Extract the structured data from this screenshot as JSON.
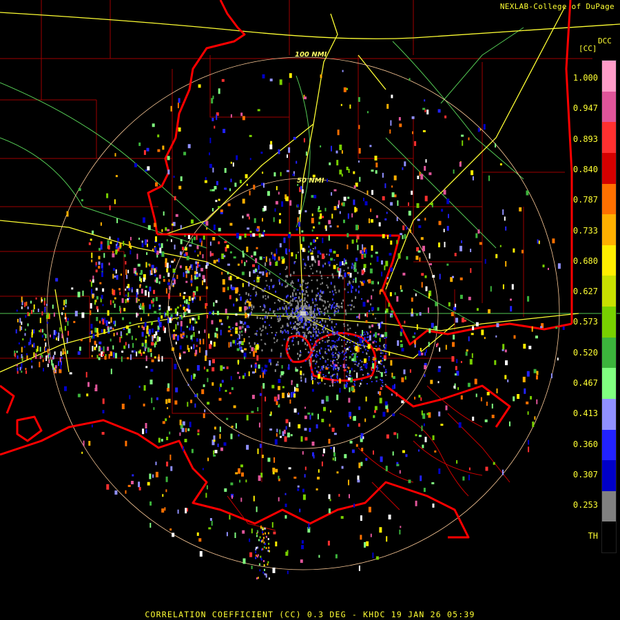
{
  "header": {
    "credit": "NEXLAB-College of DuPage"
  },
  "footer": {
    "title": "CORRELATION COEFFICIENT (CC) 0.3 DEG - KHDC 19 JAN 26 05:39"
  },
  "legend": {
    "product": "DCC",
    "unit": "[CC]",
    "ticks": [
      "1.000",
      "0.947",
      "0.893",
      "0.840",
      "0.787",
      "0.733",
      "0.680",
      "0.627",
      "0.573",
      "0.520",
      "0.467",
      "0.413",
      "0.360",
      "0.307",
      "0.253",
      "TH"
    ],
    "colors": [
      "#ff9cc8",
      "#e0559a",
      "#ff3030",
      "#d40000",
      "#ff7000",
      "#ffb000",
      "#ffee00",
      "#c8e000",
      "#78d000",
      "#3cb43c",
      "#80ff80",
      "#9090ff",
      "#2222ff",
      "#0000c8",
      "#808080",
      "#000000"
    ]
  },
  "map": {
    "range_rings": [
      "50 NMI",
      "100 NMI"
    ],
    "radar_site": "KHDC",
    "colors": {
      "state_border": "#ff0000",
      "county_lines": "#a00000",
      "highways": "#ffff33",
      "roads": "#55cc55",
      "rings": "#ffcc99"
    }
  }
}
